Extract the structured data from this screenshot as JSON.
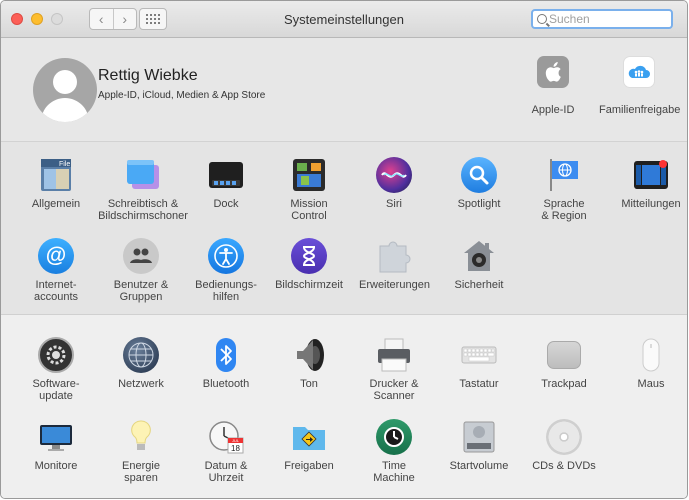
{
  "window": {
    "title": "Systemeinstellungen",
    "search": {
      "placeholder": "Suchen"
    }
  },
  "profile": {
    "name": "Rettig Wiebke",
    "subtitle": "Apple-ID, iCloud, Medien & App Store",
    "apple_id_label": "Apple-ID",
    "family_label": "Familienfreigabe"
  },
  "panes": {
    "row1": [
      "Allgemein",
      "Schreibtisch &\nBildschirmschoner",
      "Dock",
      "Mission\nControl",
      "Siri",
      "Spotlight",
      "Sprache\n& Region",
      "Mitteilungen"
    ],
    "row2": [
      "Internet-\naccounts",
      "Benutzer &\nGruppen",
      "Bedienungs-\nhilfen",
      "Bildschirmzeit",
      "Erweiterungen",
      "Sicherheit"
    ],
    "row3": [
      "Software-\nupdate",
      "Netzwerk",
      "Bluetooth",
      "Ton",
      "Drucker &\nScanner",
      "Tastatur",
      "Trackpad",
      "Maus"
    ],
    "row4": [
      "Monitore",
      "Energie\nsparen",
      "Datum &\nUhrzeit",
      "Freigaben",
      "Time\nMachine",
      "Startvolume",
      "CDs & DVDs"
    ]
  },
  "icons": {
    "apple_id": "apple-logo-icon",
    "family": "family-sharing-icon",
    "calendar_day": "18",
    "calendar_month": "JUL"
  },
  "colors": {
    "accent_blue": "#2f7df6",
    "focus_ring": "#7ab0ec"
  }
}
